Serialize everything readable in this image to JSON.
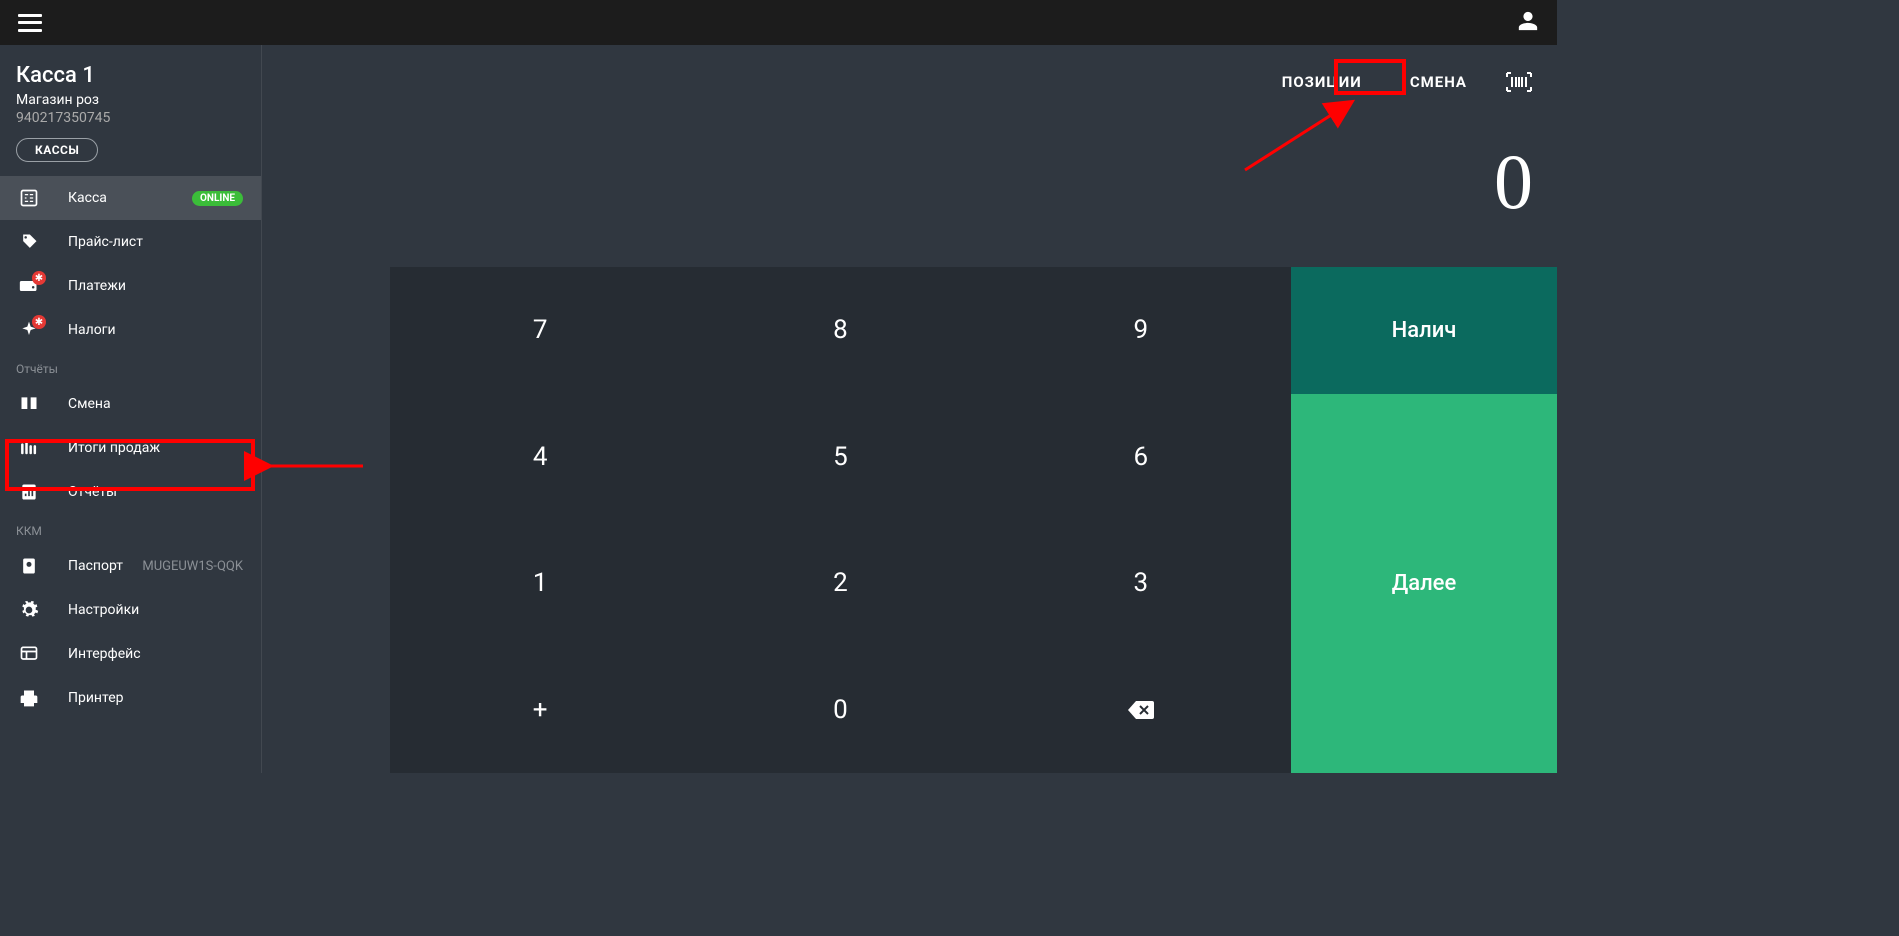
{
  "topbar": {},
  "sidebar": {
    "title": "Касса 1",
    "subtitle": "Магазин роз",
    "org_id": "940217350745",
    "kassy_btn": "КАССЫ",
    "items": [
      {
        "label": "Касса",
        "badge": "ONLINE"
      },
      {
        "label": "Прайс-лист"
      },
      {
        "label": "Платежи"
      },
      {
        "label": "Налоги"
      }
    ],
    "section_reports": "Отчёты",
    "reports": [
      {
        "label": "Смена"
      },
      {
        "label": "Итоги продаж"
      },
      {
        "label": "Отчёты"
      }
    ],
    "section_kkm": "ККМ",
    "kkm": [
      {
        "label": "Паспорт",
        "right": "MUGEUW1S-QQK"
      },
      {
        "label": "Настройки"
      },
      {
        "label": "Интерфейс"
      },
      {
        "label": "Принтер"
      }
    ]
  },
  "main": {
    "tabs": {
      "positions": "ПОЗИЦИИ",
      "shift": "СМЕНА"
    },
    "amount": "0",
    "keypad": {
      "k7": "7",
      "k8": "8",
      "k9": "9",
      "k4": "4",
      "k5": "5",
      "k6": "6",
      "k1": "1",
      "k2": "2",
      "k3": "3",
      "kplus": "+",
      "k0": "0"
    },
    "btn_cash": "Налич",
    "btn_next": "Далее"
  }
}
